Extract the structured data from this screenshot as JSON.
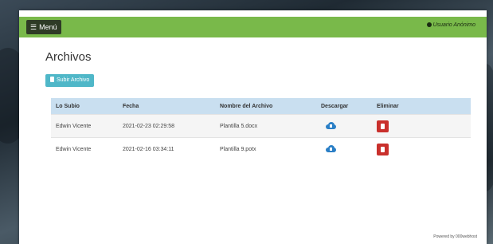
{
  "navbar": {
    "menu_label": "Menú",
    "user_label": "Usuario Anónimo",
    "color": "#79b94a"
  },
  "page": {
    "title": "Archivos",
    "upload_label": "Subir Archivo"
  },
  "table": {
    "headers": [
      "Lo Subio",
      "Fecha",
      "Nombre del Archivo",
      "Descargar",
      "Eliminar"
    ],
    "rows": [
      {
        "uploader": "Edwin Vicente",
        "date": "2021-02-23 02:29:58",
        "filename": "Plantilla 5.docx"
      },
      {
        "uploader": "Edwin Vicente",
        "date": "2021-02-16 03:34:11",
        "filename": "Plantilla 9.potx"
      }
    ]
  },
  "footer": {
    "text": "Powered by 000webhost"
  },
  "colors": {
    "header_bg": "#c9dff0",
    "upload_btn": "#4fb7c8",
    "download_icon": "#2a7fc6",
    "delete_btn": "#c9302c"
  },
  "icons": [
    "menu-bars-icon",
    "user-icon",
    "file-icon",
    "cloud-download-icon",
    "trash-icon"
  ]
}
